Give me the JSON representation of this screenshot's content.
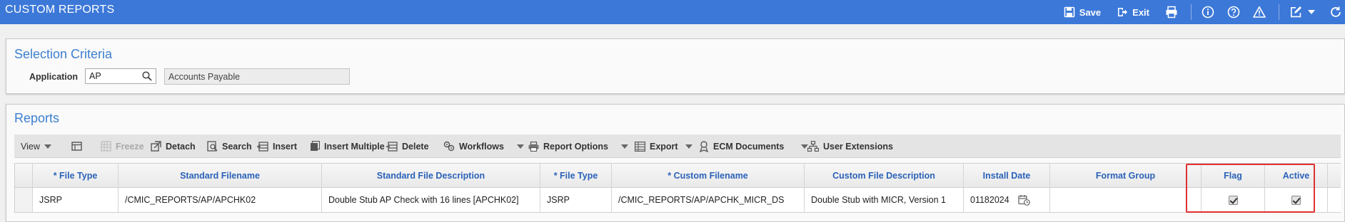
{
  "window": {
    "title": "CUSTOM REPORTS",
    "save_label": "Save",
    "exit_label": "Exit"
  },
  "selection": {
    "title": "Selection Criteria",
    "application_label": "Application",
    "application_value": "AP",
    "application_desc": "Accounts Payable"
  },
  "reports": {
    "title": "Reports",
    "toolbar": {
      "view": "View",
      "freeze": "Freeze",
      "detach": "Detach",
      "search": "Search",
      "insert": "Insert",
      "insert_multiple": "Insert Multiple",
      "delete": "Delete",
      "workflows": "Workflows",
      "report_options": "Report Options",
      "export": "Export",
      "ecm_documents": "ECM Documents",
      "user_extensions": "User Extensions"
    },
    "columns": [
      "* File Type",
      "Standard Filename",
      "Standard File Description",
      "* File Type",
      "* Custom Filename",
      "Custom File Description",
      "Install Date",
      "Format Group",
      "Flag",
      "Active"
    ],
    "rows": [
      {
        "file_type": "JSRP",
        "standard_filename": "/CMIC_REPORTS/AP/APCHK02",
        "standard_file_description": "Double Stub AP Check with 16 lines [APCHK02]",
        "custom_file_type": "JSRP",
        "custom_filename": "/CMIC_REPORTS/AP/APCHK_MICR_DS",
        "custom_file_description": "Double Stub with MICR, Version 1",
        "install_date": "01182024",
        "format_group": "",
        "flag": true,
        "active": true
      }
    ]
  },
  "colors": {
    "titlebar": "#3c78d8",
    "panel_title": "#3c7fd0",
    "header_text": "#2b62b8",
    "highlight": "#e03131"
  }
}
